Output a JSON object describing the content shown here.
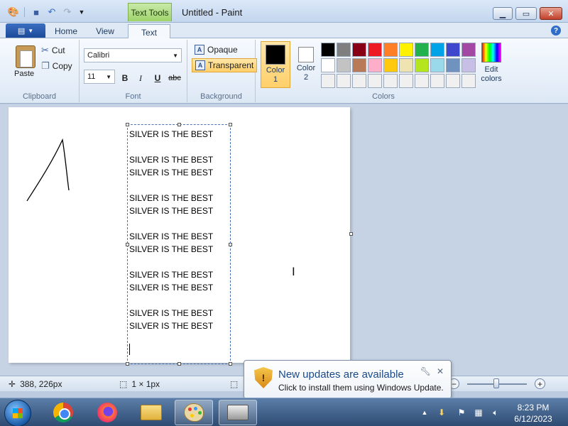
{
  "window": {
    "title": "Untitled - Paint",
    "context_tab": "Text Tools"
  },
  "tabs": {
    "file_glyph": "▤",
    "home": "Home",
    "view": "View",
    "text": "Text",
    "active": "Text"
  },
  "clipboard": {
    "paste": "Paste",
    "cut": "Cut",
    "copy": "Copy",
    "group": "Clipboard"
  },
  "font": {
    "family": "Calibri",
    "size": "11",
    "group": "Font",
    "bold": "B",
    "italic": "I",
    "underline": "U",
    "strike": "abc"
  },
  "background": {
    "opaque": "Opaque",
    "transparent": "Transparent",
    "selected": "Transparent",
    "group": "Background"
  },
  "colors": {
    "color1_label": "Color 1",
    "color2_label": "Color 2",
    "color1": "#000000",
    "color2": "#ffffff",
    "edit": "Edit colors",
    "group": "Colors",
    "palette": [
      "#000000",
      "#7f7f7f",
      "#880015",
      "#ed1c24",
      "#ff7f27",
      "#fff200",
      "#22b14c",
      "#00a2e8",
      "#3f48cc",
      "#a349a4",
      "#ffffff",
      "#c3c3c3",
      "#b97a57",
      "#ffaec9",
      "#ffc90e",
      "#efe4b0",
      "#b5e61d",
      "#99d9ea",
      "#7092be",
      "#c8bfe7",
      "#f0f0f0",
      "#f0f0f0",
      "#f0f0f0",
      "#f0f0f0",
      "#f0f0f0",
      "#f0f0f0",
      "#f0f0f0",
      "#f0f0f0",
      "#f0f0f0",
      "#f0f0f0"
    ]
  },
  "canvas": {
    "text": "SILVER IS THE BEST\n\nSILVER IS THE BEST\nSILVER IS THE BEST\n\nSILVER IS THE BEST\nSILVER IS THE BEST\n\nSILVER IS THE BEST\nSILVER IS THE BEST\n\nSILVER IS THE BEST\nSILVER IS THE BEST\n\nSILVER IS THE BEST\nSILVER IS THE BEST"
  },
  "status": {
    "cursor_pos": "388, 226px",
    "selection_size": "1 × 1px"
  },
  "notification": {
    "title": "New updates are available",
    "text": "Click to install them using Windows Update."
  },
  "taskbar": {
    "time": "8:23 PM",
    "date": "6/12/2023"
  }
}
